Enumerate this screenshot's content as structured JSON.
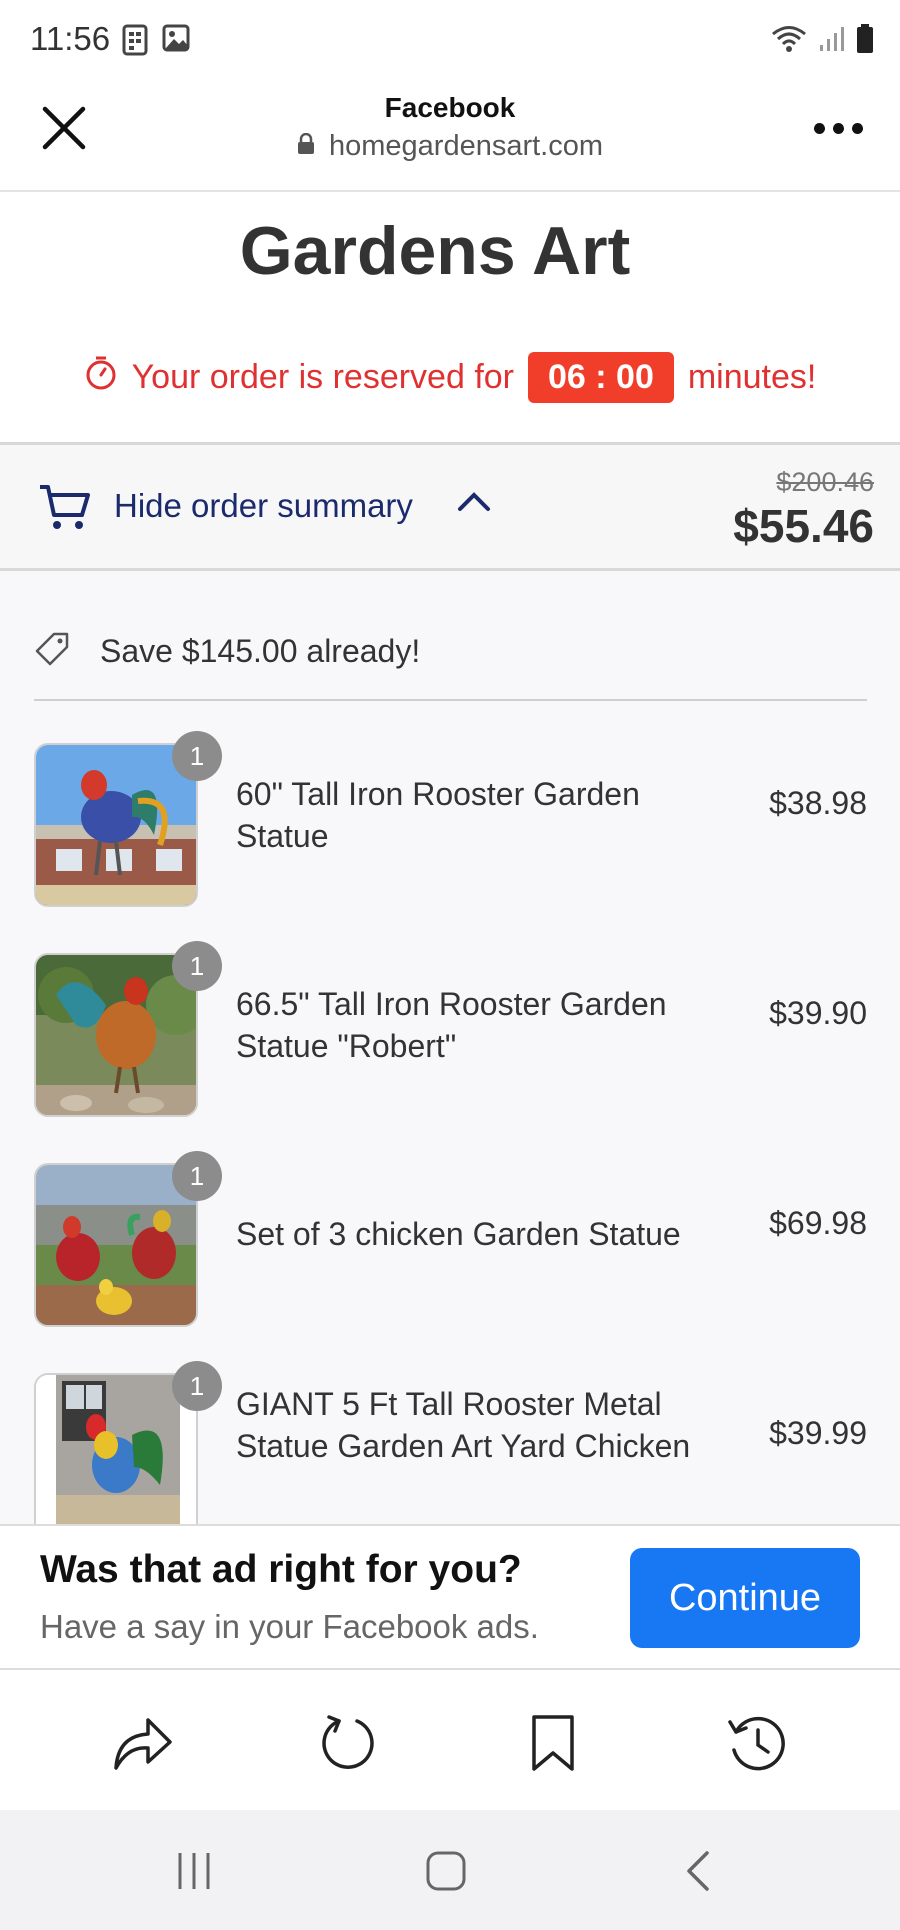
{
  "status_bar": {
    "time": "11:56",
    "left_icons": [
      "sim-card-icon",
      "gallery-icon"
    ],
    "right_icons": [
      "wifi-icon",
      "signal-icon",
      "battery-icon"
    ]
  },
  "browser": {
    "title": "Facebook",
    "url": "homegardensart.com",
    "close_icon": "close-icon",
    "more_icon": "more-icon"
  },
  "page": {
    "store_name": "Gardens Art",
    "timer": {
      "prefix": "Your order is reserved for",
      "countdown": "06 : 00",
      "suffix": "minutes!",
      "color": "#e03131"
    },
    "summary_toggle": {
      "label": "Hide order summary",
      "original_price": "$200.46",
      "total_price": "$55.46"
    },
    "savings": "Save $145.00 already!",
    "items": [
      {
        "name": "60\" Tall Iron Rooster Garden Statue",
        "price": "$38.98",
        "quantity": "1"
      },
      {
        "name": "66.5\" Tall Iron Rooster Garden Statue \"Robert\"",
        "price": "$39.90",
        "quantity": "1"
      },
      {
        "name": "Set of 3 chicken Garden Statue",
        "price": "$69.98",
        "quantity": "1"
      },
      {
        "name": "GIANT 5 Ft Tall Rooster Metal Statue Garden Art Yard Chicken",
        "price": "$39.99",
        "quantity": "1"
      }
    ]
  },
  "ad_banner": {
    "title": "Was that ad right for you?",
    "subtitle": "Have a say in your Facebook ads.",
    "button_label": "Continue",
    "button_color": "#1877f2"
  },
  "toolbar": {
    "icons": [
      "share-icon",
      "reload-icon",
      "bookmark-icon",
      "history-icon"
    ]
  },
  "nav_bar": {
    "icons": [
      "recent-apps-icon",
      "home-icon",
      "back-icon"
    ]
  }
}
